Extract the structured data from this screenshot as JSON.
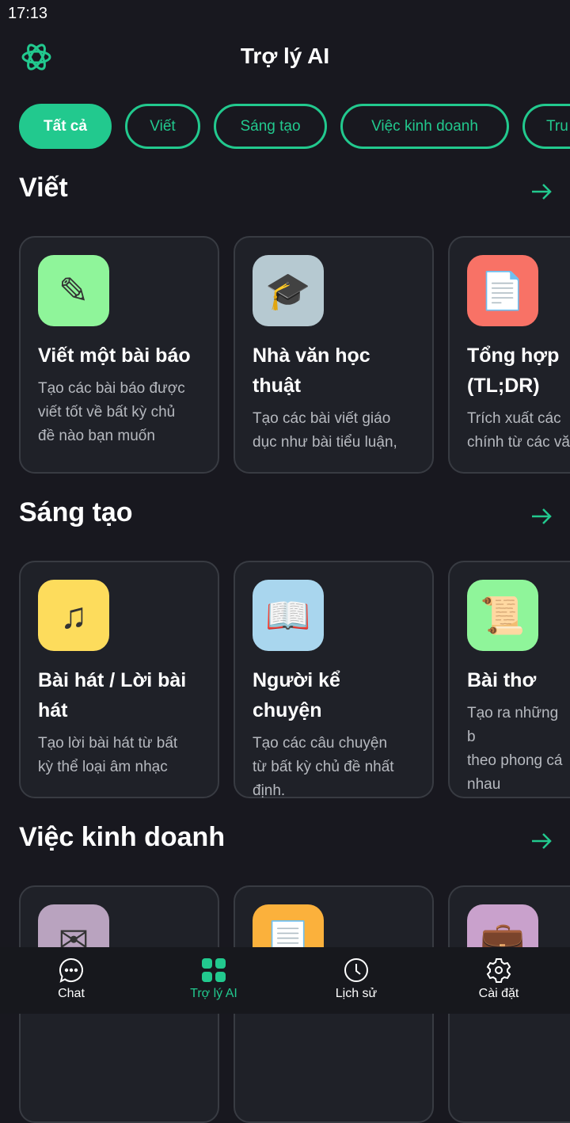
{
  "status_bar": {
    "time": "17:13"
  },
  "header": {
    "title": "Trợ lý AI",
    "logo_icon": "ai-logo-icon"
  },
  "accent_color": "#22c98e",
  "chips": [
    {
      "label": "Tất cả",
      "active": true
    },
    {
      "label": "Viết"
    },
    {
      "label": "Sáng tạo"
    },
    {
      "label": "Việc kinh doanh"
    },
    {
      "label": "Tru"
    }
  ],
  "sections": [
    {
      "title": "Viết",
      "cards": [
        {
          "title": "Viết một bài báo",
          "desc": [
            "Tạo các bài báo được",
            "viết tốt về bất kỳ chủ",
            "đề nào bạn muốn"
          ],
          "icon": "✎",
          "icon_name": "memo-pencil-icon",
          "bg": "#8ff59a"
        },
        {
          "title": "Nhà văn học thuật",
          "desc": [
            "Tạo các bài viết giáo",
            "dục như bài tiểu luận,"
          ],
          "icon": "🎓",
          "icon_name": "graduation-cap-icon",
          "bg": "#b6c9d1"
        },
        {
          "title": "Tổng hợp (TL;DR)",
          "desc": [
            "Trích xuất các",
            "chính từ các vă"
          ],
          "icon": "📄",
          "icon_name": "document-icon",
          "bg": "#f87266"
        }
      ]
    },
    {
      "title": "Sáng tạo",
      "cards": [
        {
          "title": "Bài hát / Lời bài hát",
          "desc": [
            "Tạo lời bài hát từ bất",
            "kỳ thể loại âm nhạc"
          ],
          "icon": "♫",
          "icon_name": "music-note-icon",
          "bg": "#fddc5c"
        },
        {
          "title": "Người kể chuyện",
          "desc": [
            "Tạo các câu chuyện",
            "từ bất kỳ chủ đề nhất",
            "định."
          ],
          "icon": "📖",
          "icon_name": "open-book-icon",
          "bg": "#a9d6ee"
        },
        {
          "title": "Bài thơ",
          "desc": [
            "Tạo ra những b",
            "theo phong cá",
            "nhau"
          ],
          "icon": "📜",
          "icon_name": "scroll-icon",
          "bg": "#8ff59a"
        }
      ]
    },
    {
      "title": "Việc kinh doanh",
      "cards": [
        {
          "title": "",
          "desc": [],
          "icon": "✉",
          "icon_name": "envelope-icon",
          "bg": "#b9a3bf"
        },
        {
          "title": "",
          "desc": [],
          "icon": "📃",
          "icon_name": "page-icon",
          "bg": "#fbb13c"
        },
        {
          "title": "",
          "desc": [],
          "icon": "💼",
          "icon_name": "briefcase-icon",
          "bg": "#c9a1cc"
        }
      ]
    }
  ],
  "nav": [
    {
      "label": "Chat",
      "icon": "chat-bubble-icon"
    },
    {
      "label": "Trợ lý AI",
      "icon": "grid-icon",
      "active": true
    },
    {
      "label": "Lịch sử",
      "icon": "clock-icon"
    },
    {
      "label": "Cài đặt",
      "icon": "gear-icon"
    }
  ]
}
